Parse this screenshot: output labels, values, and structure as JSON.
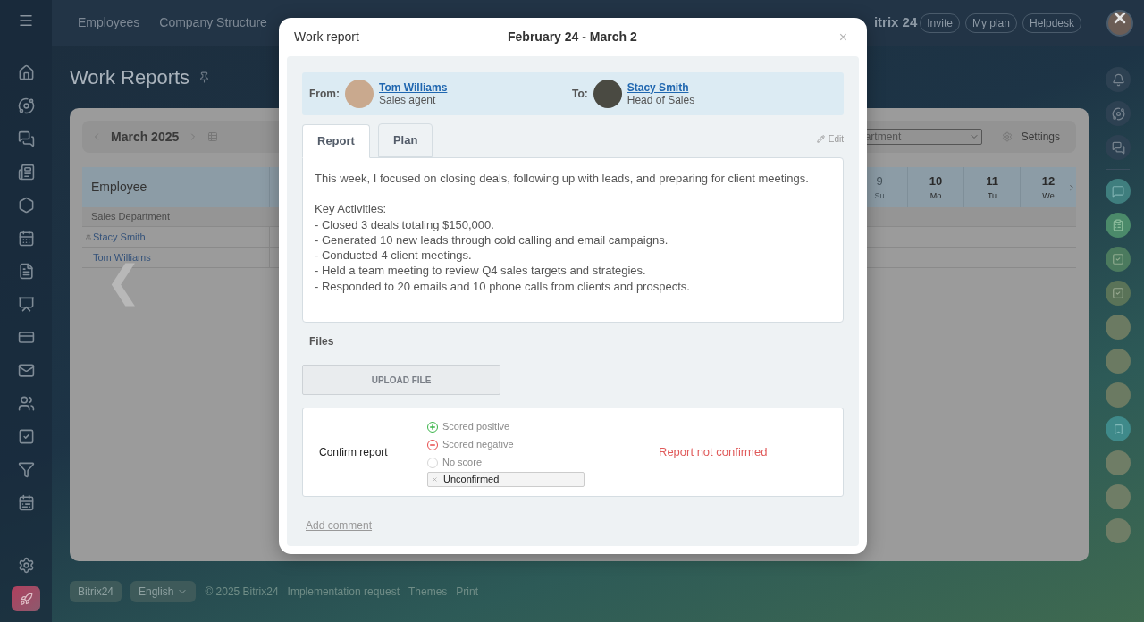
{
  "top_tabs": [
    {
      "label": "Employees",
      "selected": false
    },
    {
      "label": "Company Structure",
      "selected": false
    }
  ],
  "header": {
    "logo": "itrix 24",
    "buttons": [
      "Invite",
      "My plan",
      "Helpdesk"
    ]
  },
  "page": {
    "title": "Work Reports",
    "month": "March 2025",
    "department_select": "artment",
    "settings": "Settings",
    "table": {
      "employee_header": "Employee",
      "days": [
        {
          "day": "9",
          "weekday": "Su",
          "weekend": true
        },
        {
          "day": "10",
          "weekday": "Mo",
          "weekend": false
        },
        {
          "day": "11",
          "weekday": "Tu",
          "weekend": false
        },
        {
          "day": "12",
          "weekday": "We",
          "weekend": false
        }
      ],
      "group": "Sales Department",
      "rows": [
        {
          "name": "Stacy Smith",
          "head": true
        },
        {
          "name": "Tom Williams",
          "head": false
        }
      ]
    },
    "back_arrow": "❮"
  },
  "footer": {
    "logo": "Bitrix24",
    "language": "English",
    "copyright": "© 2025 Bitrix24",
    "links": [
      "Implementation request",
      "Themes",
      "Print"
    ]
  },
  "modal": {
    "title": "Work report",
    "period": "February 24 - March 2",
    "close": "×",
    "from": {
      "label": "From:",
      "name": "Tom Williams",
      "role": "Sales agent"
    },
    "to": {
      "label": "To:",
      "name": "Stacy Smith",
      "role": "Head of Sales"
    },
    "tabs": [
      {
        "label": "Report",
        "selected": true
      },
      {
        "label": "Plan",
        "selected": false
      }
    ],
    "edit": "Edit",
    "report_intro": "This week, I focused on closing deals, following up with leads, and preparing for client meetings.",
    "report_lines": [
      "Key Activities:",
      "- Closed 3 deals totaling $150,000.",
      "- Generated 10 new leads through cold calling and email campaigns.",
      "- Conducted 4 client meetings.",
      "- Held a team meeting to review Q4 sales targets and strategies.",
      "- Responded to 20 emails and 10 phone calls from clients and prospects."
    ],
    "files_label": "Files",
    "upload": "UPLOAD FILE",
    "confirm": {
      "label": "Confirm report",
      "options": [
        {
          "kind": "positive",
          "label": "Scored positive",
          "selected": false
        },
        {
          "kind": "negative",
          "label": "Scored negative",
          "selected": false
        },
        {
          "kind": "none",
          "label": "No score",
          "selected": false
        }
      ],
      "status_chip": "Unconfirmed",
      "status": "Report not confirmed"
    },
    "add_comment": "Add comment"
  }
}
